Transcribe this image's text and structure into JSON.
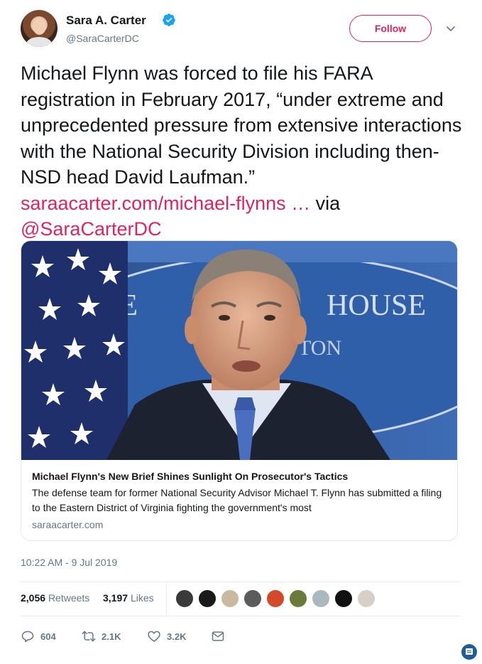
{
  "author": {
    "name": "Sara A. Carter",
    "handle": "@SaraCarterDC",
    "follow_label": "Follow"
  },
  "tweet": {
    "text_plain": "Michael Flynn was forced to file his FARA registration in February 2017, “under extreme and unprecedented pressure from extensive interactions with the National Security Division including then- NSD head David Laufman.” ",
    "link": "saraacarter.com/michael-flynns …",
    "via": " via ",
    "mention": "@SaraCarterDC"
  },
  "card": {
    "title": "Michael Flynn's New Brief Shines Sunlight On Prosecutor's Tactics",
    "description": "The defense team for former National Security Advisor Michael T. Flynn has submitted a filing to the Eastern District of Virginia fighting the government's most",
    "domain": "saraacarter.com",
    "image_text_left": "HE",
    "image_text_right": "HOUSE",
    "image_text_lower": "TON"
  },
  "timestamp": "10:22 AM - 9 Jul 2019",
  "stats": {
    "retweets_count": "2,056",
    "retweets_label": "Retweets",
    "likes_count": "3,197",
    "likes_label": "Likes"
  },
  "actions": {
    "replies": "604",
    "retweets": "2.1K",
    "likes": "3.2K"
  },
  "colors": {
    "accent": "#e0245e",
    "muted": "#657786",
    "verified": "#1da1f2"
  },
  "liker_avatar_colors": [
    "#3a3a3a",
    "#1a1a1a",
    "#c9b9a0",
    "#5b5b5b",
    "#d24a2a",
    "#6b7a3a",
    "#aab8c2",
    "#111111",
    "#d8d0c8"
  ]
}
